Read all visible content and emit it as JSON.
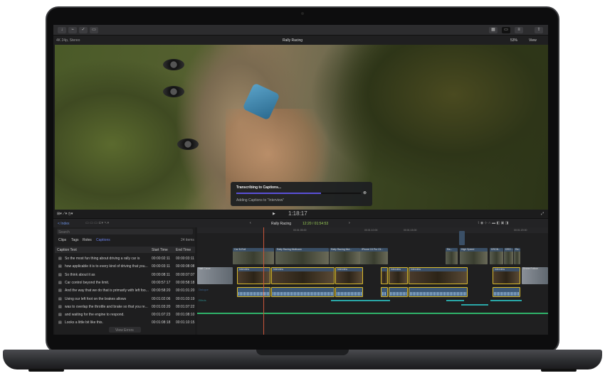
{
  "toolbar": {
    "buttons": [
      "import",
      "keywords",
      "background-tasks",
      "share"
    ]
  },
  "viewer": {
    "format": "4K 24p, Stereo",
    "title": "Rally Racing",
    "zoom": "53%",
    "view_label": "View",
    "timecode": "1:18:17"
  },
  "dialog": {
    "title": "Transcribing to Captions...",
    "subtitle": "Adding Captions to \"Interview\"",
    "progress": 0.68
  },
  "timeline_toolbar": {
    "index_label": "< Index",
    "project": "Rally Racing",
    "duration": "12:20 / 01:54:53"
  },
  "index": {
    "search_placeholder": "Search",
    "tabs": [
      "Clips",
      "Tags",
      "Roles",
      "Captions"
    ],
    "active_tab": "Captions",
    "count": "24 items",
    "columns": [
      "Caption Text",
      "Start Time",
      "End Time"
    ],
    "rows": [
      {
        "text": "So the most fun thing about driving a rally car is",
        "start": "00:00:02:11",
        "end": "00:00:03:11"
      },
      {
        "text": "how applicable it is to every kind of driving that you...",
        "start": "00:00:03:11",
        "end": "00:00:08:08"
      },
      {
        "text": "So think about it as",
        "start": "00:00:08:11",
        "end": "00:00:07:07"
      },
      {
        "text": "Car control beyond the limit.",
        "start": "00:00:57:17",
        "end": "00:00:58:18"
      },
      {
        "text": "And the way that we do that is primarily with left foo...",
        "start": "00:00:58:20",
        "end": "00:01:01:20"
      },
      {
        "text": "Using our left foot on the brakes allows",
        "start": "00:01:02:06",
        "end": "00:01:03:19"
      },
      {
        "text": "was to overlap the throttle and brake so that you re...",
        "start": "00:01:03:20",
        "end": "00:01:07:22"
      },
      {
        "text": "and waiting for the engine to respond.",
        "start": "00:01:07:23",
        "end": "00:01:08:10"
      },
      {
        "text": "Looks a little bit like this.",
        "start": "00:01:08:18",
        "end": "00:01:10:15"
      }
    ],
    "view_errors": "View Errors"
  },
  "timeline": {
    "ruler": [
      "00:01:05:00",
      "00:01:10:00",
      "00:01:15:00",
      "00:01:20:00"
    ],
    "connected": [
      "Car B-Roll",
      "Rally Racing Multicam",
      "Rally Racing Mul...",
      "iPhone 15 Pro Cli...",
      "Ra...",
      "High Speed",
      "DRON...",
      "DRO...",
      "Ra..."
    ],
    "primary": [
      "Half Curve",
      "Interview",
      "Interview",
      "Interview",
      "",
      "Interview",
      "Interview",
      "Interview",
      "Drone Follow"
    ],
    "roles": [
      "Dialogue",
      "Effects"
    ]
  },
  "colors": {
    "accent": "#5a50d8",
    "selection": "#d8b92c",
    "playhead": "#c8553a"
  }
}
